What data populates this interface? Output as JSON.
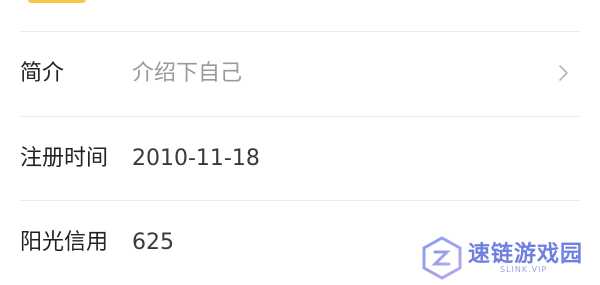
{
  "profile": {
    "rows": [
      {
        "label": "简介",
        "value": "介绍下自己",
        "placeholder": true,
        "has_chevron": true
      },
      {
        "label": "注册时间",
        "value": "2010-11-18",
        "placeholder": false,
        "has_chevron": false
      },
      {
        "label": "阳光信用",
        "value": "625",
        "placeholder": false,
        "has_chevron": false
      }
    ]
  },
  "watermark": {
    "title": "速链游戏园",
    "subtitle": "SLINK.VIP"
  },
  "icons": {
    "chevron": "chevron-right-icon",
    "logo": "watermark-logo-icon"
  },
  "colors": {
    "accent": "#f3c84a",
    "watermark": "#6f7fe0",
    "placeholder": "#9a9a9a"
  }
}
